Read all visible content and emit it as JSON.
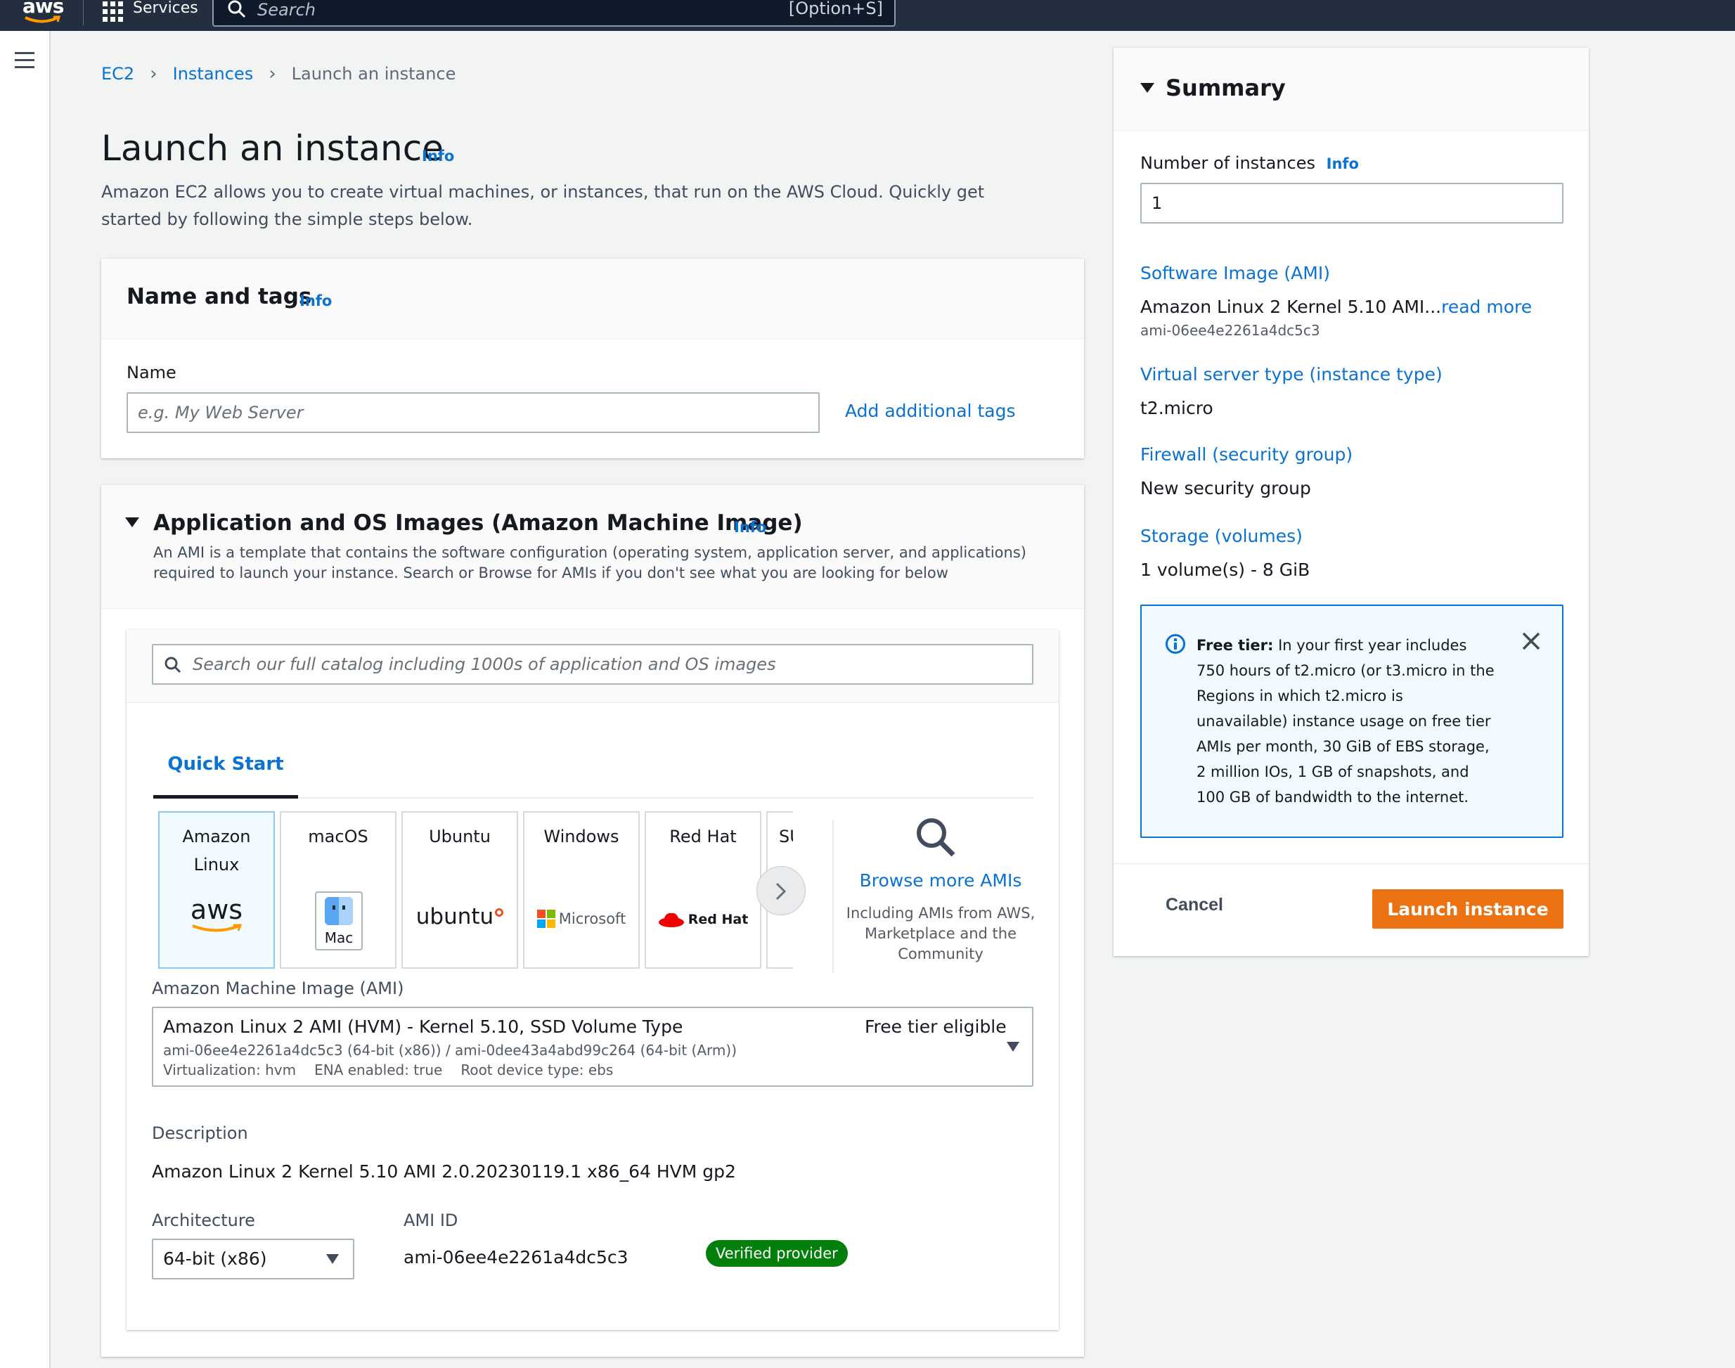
{
  "topnav": {
    "logo_text": "aws",
    "services_label": "Services",
    "search_placeholder": "Search",
    "search_shortcut": "[Option+S]"
  },
  "breadcrumb": {
    "items": [
      "EC2",
      "Instances"
    ],
    "current": "Launch an instance"
  },
  "page": {
    "title": "Launch an instance",
    "info": "Info",
    "description": "Amazon EC2 allows you to create virtual machines, or instances, that run on the AWS Cloud. Quickly get started by following the simple steps below."
  },
  "name_tags": {
    "title": "Name and tags",
    "info": "Info",
    "name_label": "Name",
    "name_placeholder": "e.g. My Web Server",
    "add_tags": "Add additional tags"
  },
  "ami": {
    "title": "Application and OS Images (Amazon Machine Image)",
    "info": "Info",
    "description": "An AMI is a template that contains the software configuration (operating system, application server, and applications) required to launch your instance. Search or Browse for AMIs if you don't see what you are looking for below",
    "search_placeholder": "Search our full catalog including 1000s of application and OS images",
    "tab": "Quick Start",
    "os_tiles": [
      "Amazon Linux",
      "macOS",
      "Ubuntu",
      "Windows",
      "Red Hat",
      "SU"
    ],
    "tile_logos": {
      "aws": "aws",
      "mac": "Mac",
      "ubuntu": "ubuntu",
      "microsoft": "Microsoft",
      "redhat": "Red Hat"
    },
    "browse_label": "Browse more AMIs",
    "browse_sub": "Including AMIs from AWS, Marketplace and the Community",
    "ami_label": "Amazon Machine Image (AMI)",
    "selected": {
      "name": "Amazon Linux 2 AMI (HVM) - Kernel 5.10, SSD Volume Type",
      "free_tier": "Free tier eligible",
      "ids": "ami-06ee4e2261a4dc5c3 (64-bit (x86)) / ami-0dee43a4abd99c264 (64-bit (Arm))",
      "virtualization": "Virtualization: hvm",
      "ena": "ENA enabled: true",
      "root_device": "Root device type: ebs"
    },
    "description_label": "Description",
    "description_value": "Amazon Linux 2 Kernel 5.10 AMI 2.0.20230119.1 x86_64 HVM gp2",
    "architecture_label": "Architecture",
    "architecture_value": "64-bit (x86)",
    "ami_id_label": "AMI ID",
    "ami_id_value": "ami-06ee4e2261a4dc5c3",
    "verified": "Verified provider"
  },
  "summary": {
    "title": "Summary",
    "instances_label": "Number of instances",
    "info": "Info",
    "instances_value": "1",
    "software_label": "Software Image (AMI)",
    "software_value": "Amazon Linux 2 Kernel 5.10 AMI...",
    "read_more": "read more",
    "software_id": "ami-06ee4e2261a4dc5c3",
    "type_label": "Virtual server type (instance type)",
    "type_value": "t2.micro",
    "firewall_label": "Firewall (security group)",
    "firewall_value": "New security group",
    "storage_label": "Storage (volumes)",
    "storage_value": "1 volume(s) - 8 GiB",
    "free_tier_title": "Free tier:",
    "free_tier_text": " In your first year includes 750 hours of t2.micro (or t3.micro in the Regions in which t2.micro is unavailable) instance usage on free tier AMIs per month, 30 GiB of EBS storage, 2 million IOs, 1 GB of snapshots, and 100 GB of bandwidth to the internet.",
    "cancel": "Cancel",
    "launch": "Launch instance"
  },
  "colors": {
    "nav": "#232f3e",
    "link": "#0972d3",
    "primary": "#ec7211",
    "verified": "#037f0c"
  }
}
